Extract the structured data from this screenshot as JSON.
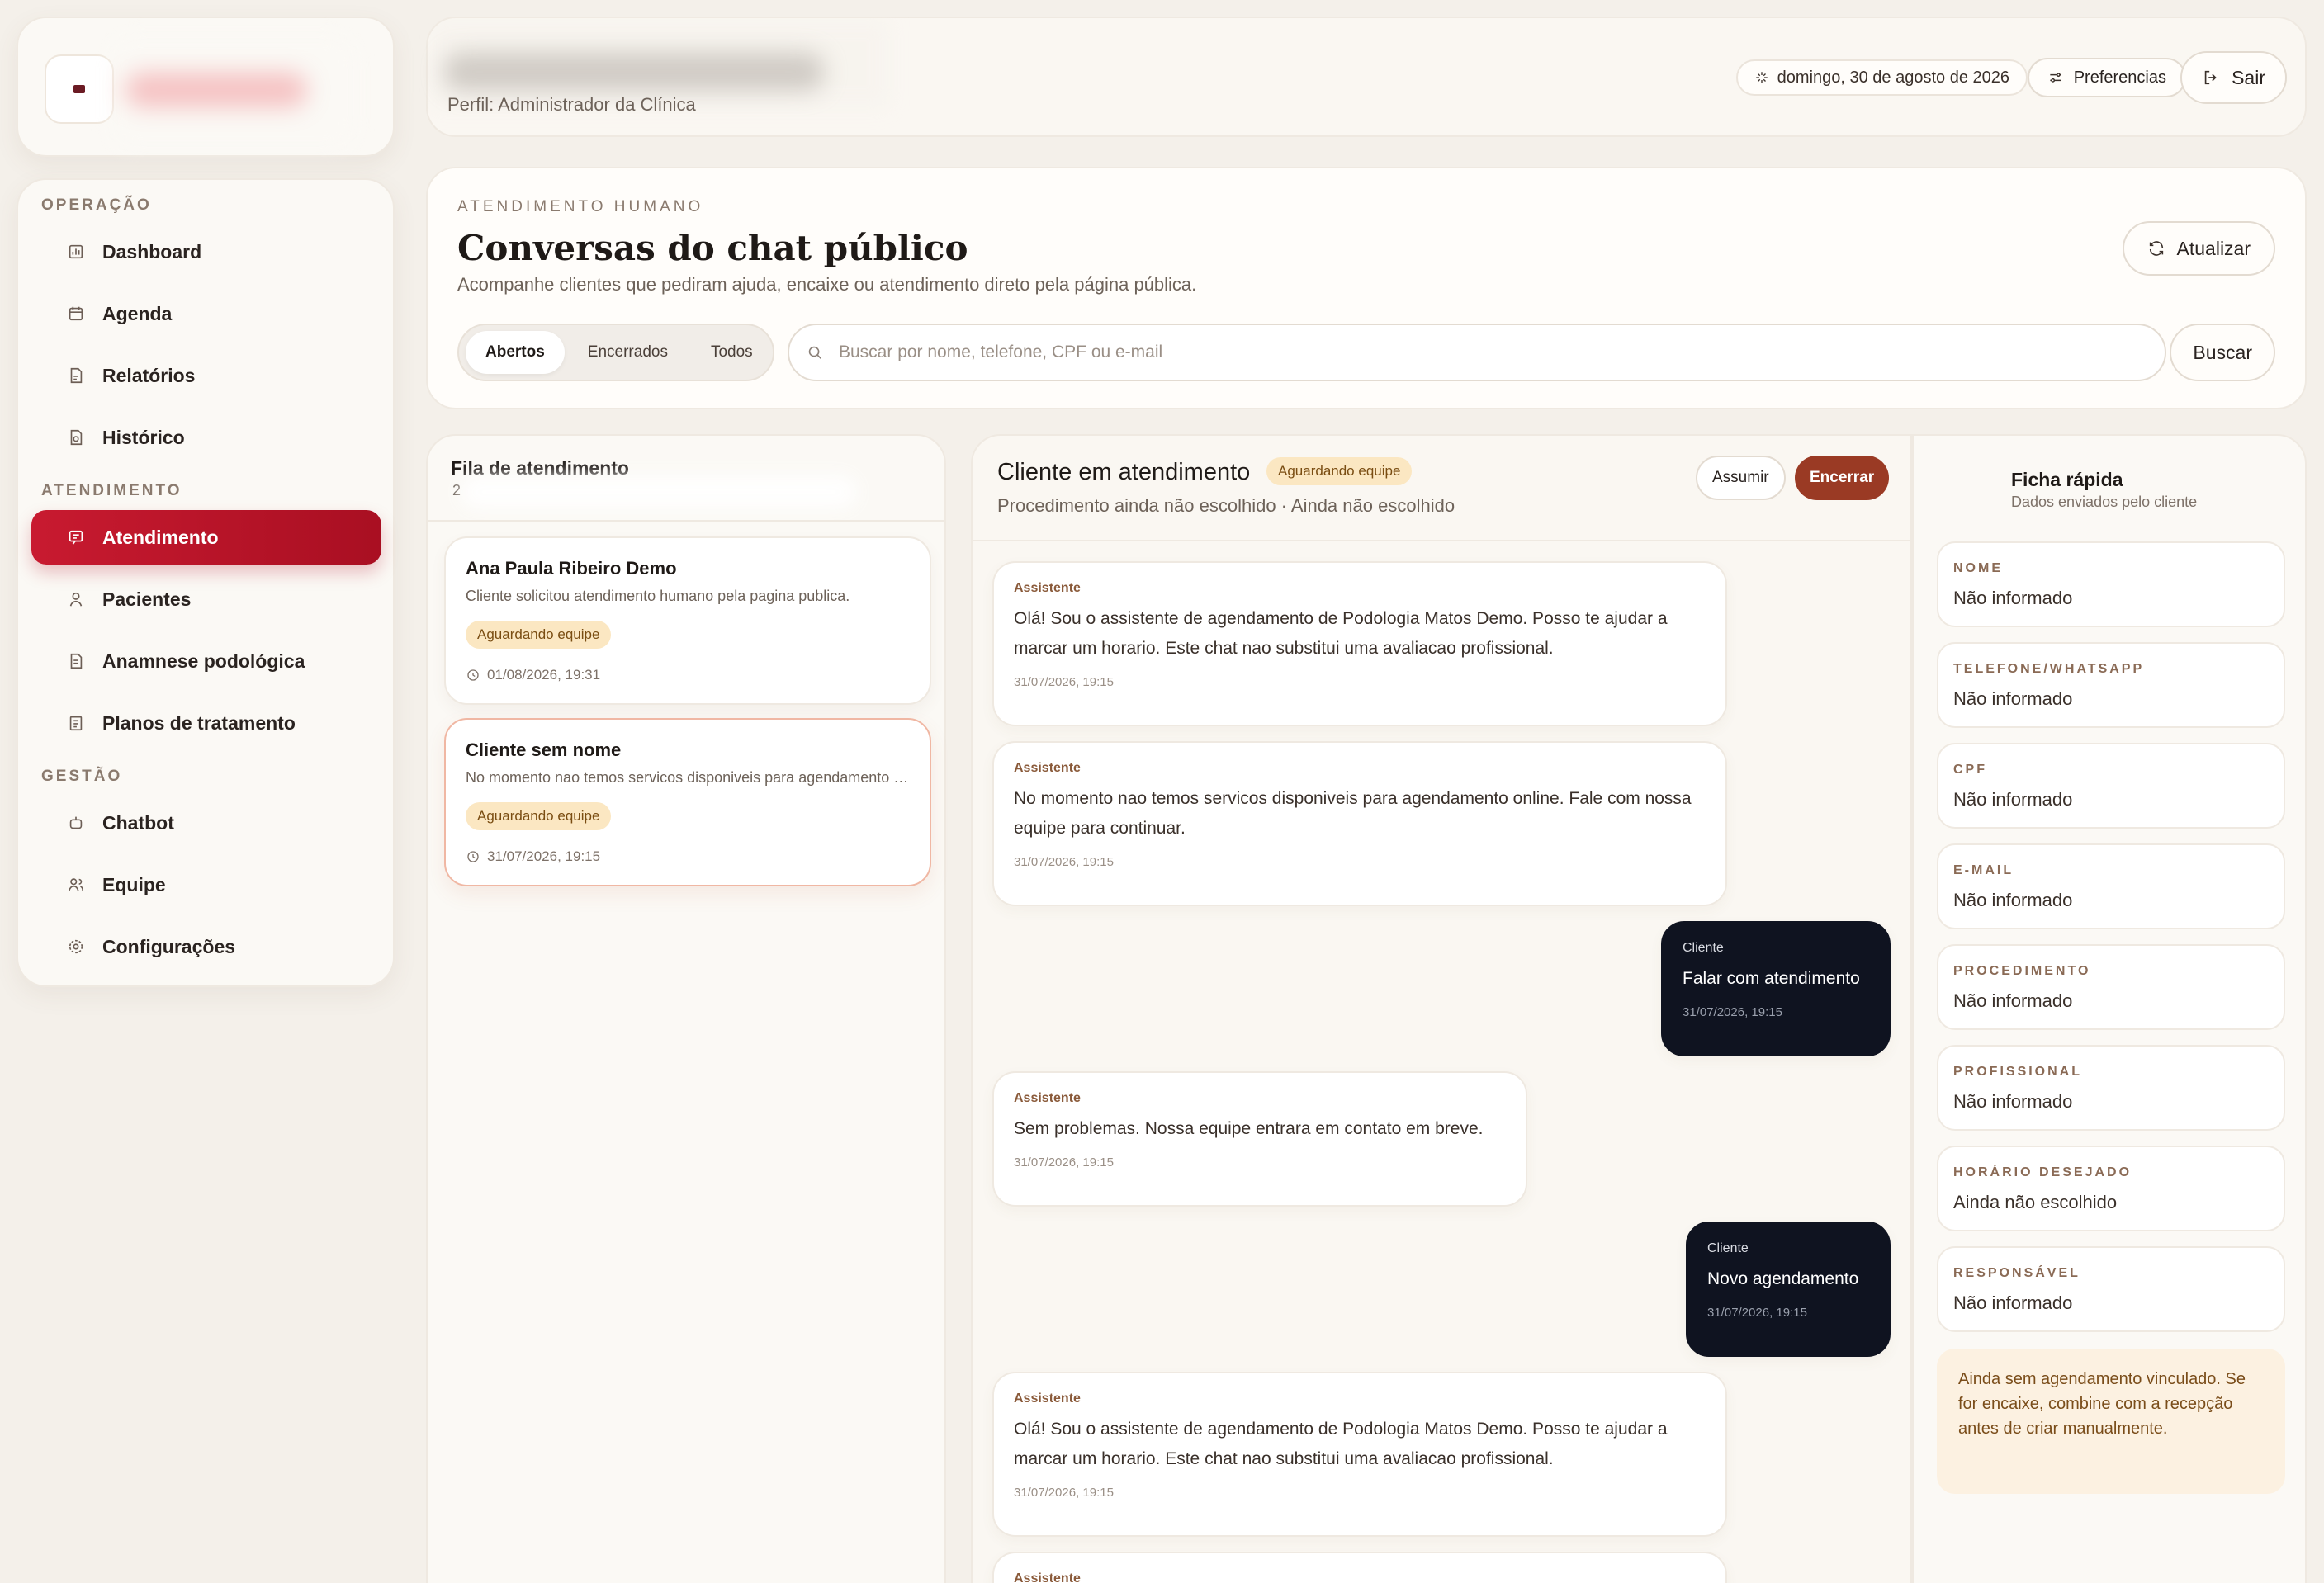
{
  "header": {
    "profile": "Perfil: Administrador da Clínica",
    "date": "domingo, 30 de agosto de 2026",
    "preferences_label": "Preferencias",
    "logout_label": "Sair"
  },
  "sidebar": {
    "sections": [
      {
        "label": "OPERAÇÃO"
      },
      {
        "label": "ATENDIMENTO"
      },
      {
        "label": "GESTÃO"
      }
    ],
    "items": [
      {
        "label": "Dashboard",
        "icon": "dashboard-icon"
      },
      {
        "label": "Agenda",
        "icon": "calendar-icon"
      },
      {
        "label": "Relatórios",
        "icon": "report-icon"
      },
      {
        "label": "Histórico",
        "icon": "history-icon"
      },
      {
        "label": "Atendimento",
        "icon": "chat-icon",
        "active": true
      },
      {
        "label": "Pacientes",
        "icon": "user-icon"
      },
      {
        "label": "Anamnese podológica",
        "icon": "document-icon"
      },
      {
        "label": "Planos de tratamento",
        "icon": "clipboard-icon"
      },
      {
        "label": "Chatbot",
        "icon": "bot-icon"
      },
      {
        "label": "Equipe",
        "icon": "team-icon"
      },
      {
        "label": "Configurações",
        "icon": "gear-icon"
      }
    ]
  },
  "main": {
    "eyebrow": "ATENDIMENTO HUMANO",
    "title": "Conversas do chat público",
    "subtitle": "Acompanhe clientes que pediram ajuda, encaixe ou atendimento direto pela página pública.",
    "refresh_label": "Atualizar",
    "filters": [
      {
        "label": "Abertos",
        "active": true
      },
      {
        "label": "Encerrados"
      },
      {
        "label": "Todos"
      }
    ],
    "search_placeholder": "Buscar por nome, telefone, CPF ou e-mail",
    "search_button": "Buscar"
  },
  "queue": {
    "title": "Fila de atendimento",
    "count": "2",
    "items": [
      {
        "name": "Ana Paula Ribeiro Demo",
        "message": "Cliente solicitou atendimento humano pela pagina publica.",
        "status": "Aguardando equipe",
        "time": "01/08/2026, 19:31"
      },
      {
        "name": "Cliente sem nome",
        "message": "No momento nao temos servicos disponiveis para agendamento online. Fale com nossa equipe para continuar.",
        "status": "Aguardando equipe",
        "time": "31/07/2026, 19:15"
      }
    ]
  },
  "chat": {
    "title": "Cliente em atendimento",
    "status": "Aguardando equipe",
    "subtitle": "Procedimento ainda não escolhido · Ainda não escolhido",
    "assume_label": "Assumir",
    "close_label": "Encerrar",
    "messages": [
      {
        "sender": "Assistente",
        "text": "Olá! Sou o assistente de agendamento de Podologia Matos Demo. Posso te ajudar a marcar um horario. Este chat nao substitui uma avaliacao profissional.",
        "time": "31/07/2026, 19:15"
      },
      {
        "sender": "Assistente",
        "text": "No momento nao temos servicos disponiveis para agendamento online. Fale com nossa equipe para continuar.",
        "time": "31/07/2026, 19:15"
      },
      {
        "sender": "Cliente",
        "text": "Falar com atendimento",
        "time": "31/07/2026, 19:15"
      },
      {
        "sender": "Assistente",
        "text": "Sem problemas. Nossa equipe entrara em contato em breve.",
        "time": "31/07/2026, 19:15"
      },
      {
        "sender": "Cliente",
        "text": "Novo agendamento",
        "time": "31/07/2026, 19:15"
      },
      {
        "sender": "Assistente",
        "text": "Olá! Sou o assistente de agendamento de Podologia Matos Demo. Posso te ajudar a marcar um horario. Este chat nao substitui uma avaliacao profissional.",
        "time": "31/07/2026, 19:15"
      },
      {
        "sender": "Assistente"
      }
    ]
  },
  "ficha": {
    "title": "Ficha rápida",
    "subtitle": "Dados enviados pelo cliente",
    "fields": [
      {
        "label": "NOME",
        "value": "Não informado"
      },
      {
        "label": "TELEFONE/WHATSAPP",
        "value": "Não informado"
      },
      {
        "label": "CPF",
        "value": "Não informado"
      },
      {
        "label": "E-MAIL",
        "value": "Não informado"
      },
      {
        "label": "PROCEDIMENTO",
        "value": "Não informado"
      },
      {
        "label": "PROFISSIONAL",
        "value": "Não informado"
      },
      {
        "label": "HORÁRIO DESEJADO",
        "value": "Ainda não escolhido"
      },
      {
        "label": "RESPONSÁVEL",
        "value": "Não informado"
      }
    ],
    "note": "Ainda sem agendamento vinculado. Se for encaixe, combine com a recepção antes de criar manualmente."
  },
  "colors": {
    "accent": "#c81a30",
    "close_button": "#9a3a24",
    "badge_bg": "#fbe7c2",
    "client_bubble": "#0f1320"
  }
}
